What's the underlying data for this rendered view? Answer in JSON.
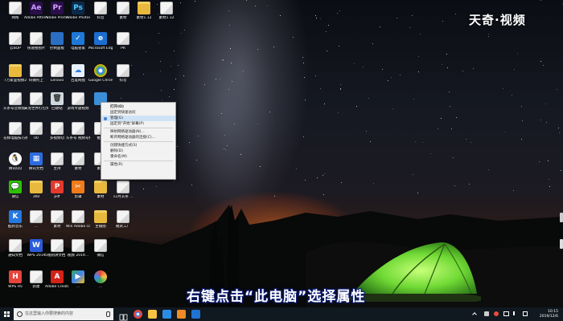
{
  "overlay": {
    "logo_text": "天奇·视频",
    "subtitle": "右键点击“此电脑”选择属性"
  },
  "desktop": {
    "icons": [
      {
        "label": "网络",
        "kind": "file"
      },
      {
        "label": "Adobe After Effects CC ...",
        "kind": "ae"
      },
      {
        "label": "Adobe Premiere P...",
        "kind": "pr"
      },
      {
        "label": "Adobe Photosh...",
        "kind": "ps"
      },
      {
        "label": "抖音",
        "kind": "file"
      },
      {
        "label": "素材",
        "kind": "file"
      },
      {
        "label": "素材1.12",
        "kind": "folder"
      },
      {
        "label": "素材1.12",
        "kind": "file"
      },
      {
        "label": "云BOP",
        "kind": "file"
      },
      {
        "label": "快速搜图片",
        "kind": "file"
      },
      {
        "label": "控制面板",
        "kind": "panel"
      },
      {
        "label": "电脑管家",
        "kind": "shield"
      },
      {
        "label": "Microsoft Edge",
        "kind": "edge"
      },
      {
        "label": "PR",
        "kind": "file"
      },
      {
        "label": "7万家里视频2",
        "kind": "folder"
      },
      {
        "label": "码钢托上",
        "kind": "file"
      },
      {
        "label": "Lenovo",
        "kind": "file"
      },
      {
        "label": "百度网盘",
        "kind": "cloud"
      },
      {
        "label": "Google Chrome",
        "kind": "chrome"
      },
      {
        "label": "抖音",
        "kind": "file"
      },
      {
        "label": "头条号音频加码包",
        "kind": "file"
      },
      {
        "label": "天龙世界打包文章下载",
        "kind": "file"
      },
      {
        "label": "回收站",
        "kind": "bin"
      },
      {
        "label": "游戏专题视频",
        "kind": "file"
      },
      {
        "label": "...",
        "kind": "pc"
      },
      {
        "label": "花样电脑技巧视频...",
        "kind": "file"
      },
      {
        "label": "00",
        "kind": "file"
      },
      {
        "label": "多视频切",
        "kind": "file"
      },
      {
        "label": "头条号 视频号推荐",
        "kind": "file"
      },
      {
        "label": "推荐",
        "kind": "file"
      },
      {
        "label": "腾讯QQ",
        "kind": "qq"
      },
      {
        "label": "腾讯文档",
        "kind": "grid"
      },
      {
        "label": "主持",
        "kind": "file"
      },
      {
        "label": "素材",
        "kind": "file"
      },
      {
        "label": "素材",
        "kind": "file"
      },
      {
        "label": "微信",
        "kind": "wechat"
      },
      {
        "label": "360",
        "kind": "folder"
      },
      {
        "label": "pdf",
        "kind": "pdf"
      },
      {
        "label": "剪辑",
        "kind": "tool"
      },
      {
        "label": "素材",
        "kind": "folder"
      },
      {
        "label": "12月头条 ...",
        "kind": "file"
      },
      {
        "label": "酷狗音乐",
        "kind": "kugou"
      },
      {
        "label": "...",
        "kind": "file"
      },
      {
        "label": "素材",
        "kind": "file"
      },
      {
        "label": "Win Adobe cc 2018 ...",
        "kind": "file"
      },
      {
        "label": "主播图",
        "kind": "folder"
      },
      {
        "label": "模式工厂",
        "kind": "file"
      },
      {
        "label": "通知文档",
        "kind": "file"
      },
      {
        "label": "WPS 2019",
        "kind": "wps"
      },
      {
        "label": "5规则讲文档 ...",
        "kind": "file"
      },
      {
        "label": "视频 2019...",
        "kind": "file"
      },
      {
        "label": "微信",
        "kind": "file"
      },
      {
        "label": "WPS H5",
        "kind": "wpsh5"
      },
      {
        "label": "新建",
        "kind": "file"
      },
      {
        "label": "Adobe Creati...",
        "kind": "acrobat"
      },
      {
        "label": "...",
        "kind": "play"
      },
      {
        "label": "...",
        "kind": "flower"
      }
    ]
  },
  "context_menu": {
    "items": [
      {
        "label": "打开(O)",
        "bold": true
      },
      {
        "label": "固定到快速访问"
      },
      {
        "label": "管理(G)",
        "highlight": true,
        "icon": true
      },
      {
        "label": "固定到\"开始\"屏幕(P)"
      },
      {
        "sep": true
      },
      {
        "label": "映射网络驱动器(N)..."
      },
      {
        "label": "断开网络驱动器的连接(C)..."
      },
      {
        "sep": true
      },
      {
        "label": "创建快捷方式(S)"
      },
      {
        "label": "删除(D)"
      },
      {
        "label": "重命名(M)"
      },
      {
        "sep": true
      },
      {
        "label": "属性(R)"
      }
    ]
  },
  "taskbar": {
    "search_placeholder": "在这里输入你要搜索的内容",
    "time": "10:15",
    "date": "2019/12/6"
  },
  "colors": {
    "accent": "#0078d7",
    "subtitle_outline": "#0a1a70",
    "tent": "#7be03a"
  }
}
